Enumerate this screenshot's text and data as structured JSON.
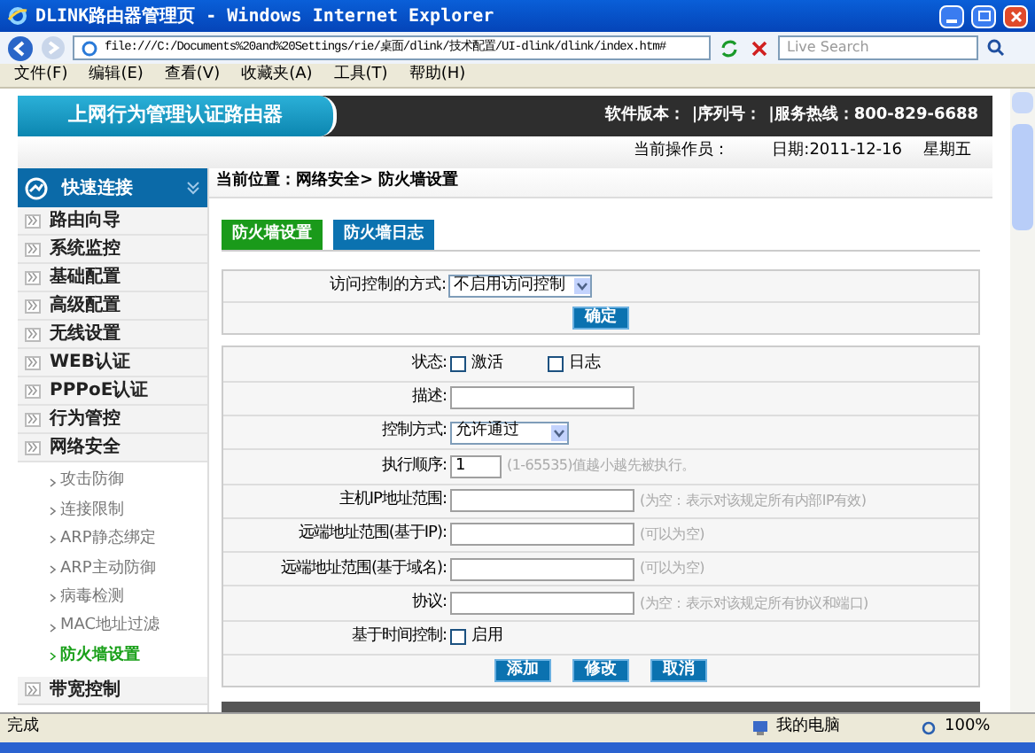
{
  "window": {
    "title": "DLINK路由器管理页 - Windows Internet Explorer"
  },
  "browser": {
    "address": "file:///C:/Documents%20and%20Settings/rie/桌面/dlink/技术配置/UI-dlink/dlink/index.htm#",
    "search_placeholder": "Live Search",
    "menu": [
      "文件(F)",
      "编辑(E)",
      "查看(V)",
      "收藏夹(A)",
      "工具(T)",
      "帮助(H)"
    ]
  },
  "header": {
    "title": "上网行为管理认证路由器",
    "info": [
      "软件版本：",
      "|序列号：",
      "|服务热线：800-829-6688"
    ],
    "operator": "当前操作员：",
    "date": "日期:2011-12-16",
    "weekday": "星期五"
  },
  "sidebar": {
    "title": "快速连接",
    "items": [
      {
        "kind": "item",
        "label": "路由向导",
        "selected": false
      },
      {
        "kind": "item",
        "label": "系统监控",
        "selected": false
      },
      {
        "kind": "item",
        "label": "基础配置",
        "selected": false
      },
      {
        "kind": "item",
        "label": "高级配置",
        "selected": false
      },
      {
        "kind": "item",
        "label": "无线设置",
        "selected": false
      },
      {
        "kind": "item",
        "label": "WEB认证",
        "selected": false
      },
      {
        "kind": "item",
        "label": "PPPoE认证",
        "selected": false
      },
      {
        "kind": "item",
        "label": "行为管控",
        "selected": false
      },
      {
        "kind": "item",
        "label": "网络安全",
        "selected": false,
        "children": [
          {
            "label": "攻击防御",
            "selected": false
          },
          {
            "label": "连接限制",
            "selected": false
          },
          {
            "label": "ARP静态绑定",
            "selected": false
          },
          {
            "label": "ARP主动防御",
            "selected": false
          },
          {
            "label": "病毒检测",
            "selected": false
          },
          {
            "label": "MAC地址过滤",
            "selected": false
          },
          {
            "label": "防火墙设置",
            "selected": true
          }
        ]
      },
      {
        "kind": "item",
        "label": "带宽控制",
        "selected": false
      }
    ]
  },
  "breadcrumb": "当前位置：网络安全> 防火墙设置",
  "tabs": [
    {
      "label": "防火墙设置",
      "selected": true
    },
    {
      "label": "防火墙日志",
      "selected": false
    }
  ],
  "access": {
    "label": "访问控制的方式:",
    "value": "不启用访问控制",
    "button": "确定"
  },
  "rule_rows": [
    {
      "kind": "checks",
      "label": "状态:",
      "options": [
        {
          "label": "激活",
          "checked": false
        },
        {
          "label": "日志",
          "checked": false
        }
      ]
    },
    {
      "kind": "input",
      "label": "描述:"
    },
    {
      "kind": "select",
      "label": "控制方式:",
      "value": "允许通过"
    },
    {
      "kind": "number",
      "label": "执行顺序:",
      "value": "1",
      "hint": "(1-65535)值越小越先被执行。"
    },
    {
      "kind": "input",
      "label": "主机IP地址范围:",
      "hint": "(为空：表示对该规定所有内部IP有效)"
    },
    {
      "kind": "input",
      "label": "远端地址范围(基于IP):",
      "hint": "(可以为空)"
    },
    {
      "kind": "input",
      "label": "远端地址范围(基于域名):",
      "hint": "(可以为空)"
    },
    {
      "kind": "input",
      "label": "协议:",
      "hint": "(为空：表示对该规定所有协议和端口)"
    },
    {
      "kind": "checks",
      "label": "基于时间控制:",
      "options": [
        {
          "label": "启用",
          "checked": false
        }
      ]
    }
  ],
  "rule_buttons": [
    "添加",
    "修改",
    "取消"
  ],
  "status_bar": {
    "text": "完成",
    "zone": "我的电脑",
    "zoom": "100%"
  }
}
